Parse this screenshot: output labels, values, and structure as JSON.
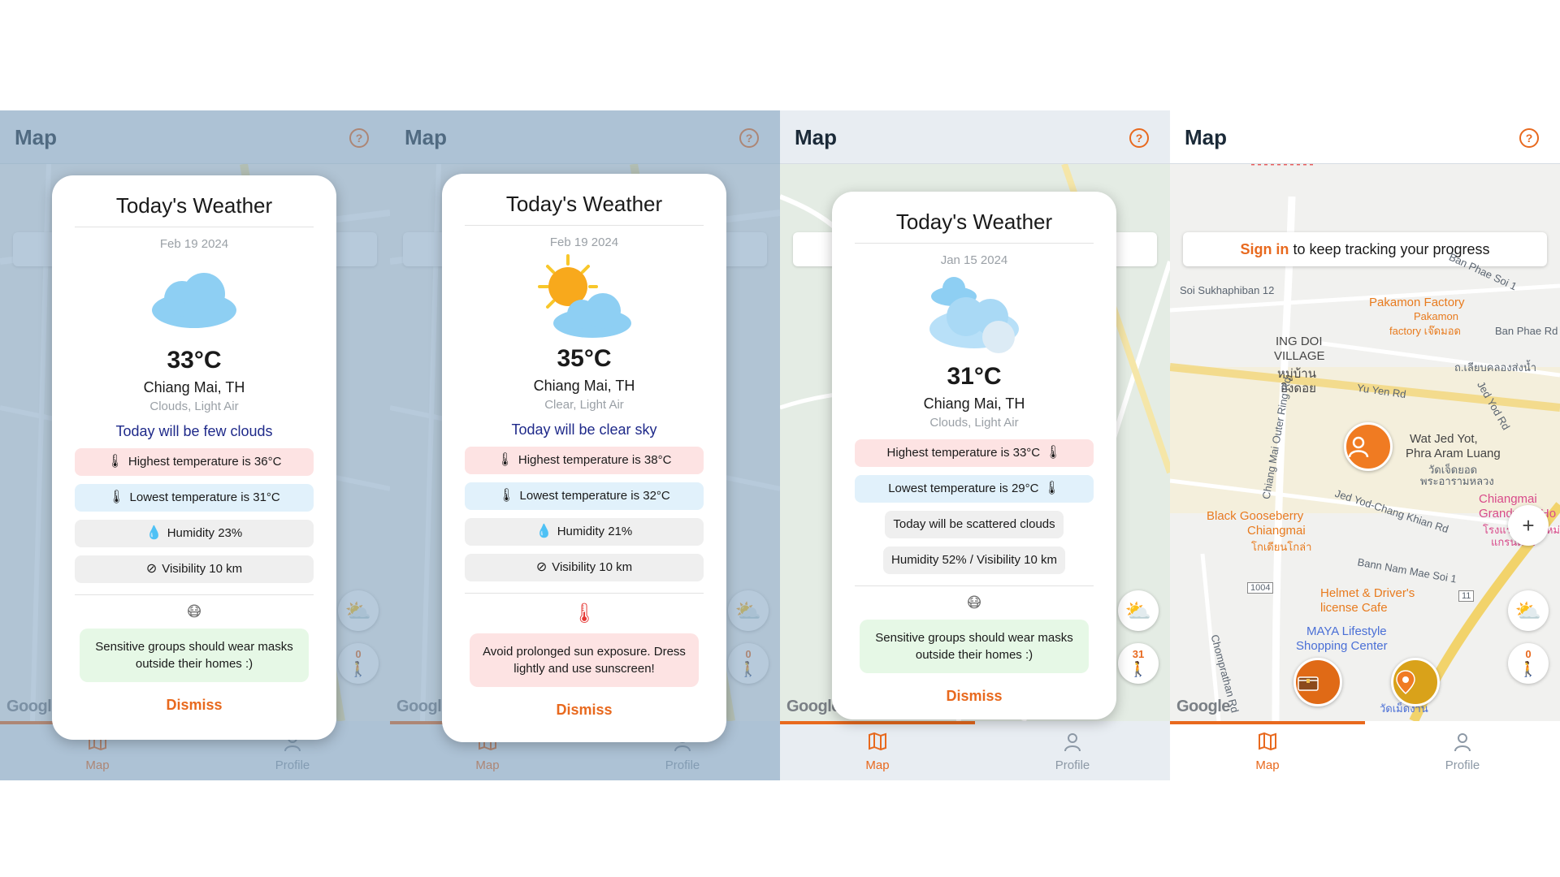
{
  "common": {
    "appbar_title": "Map",
    "help_glyph": "?",
    "google_logo": "Google",
    "nav_map": "Map",
    "nav_profile": "Profile",
    "plus_glyph": "+",
    "walk_glyph": "🚶",
    "steps_count": "0",
    "icons": [
      "question-circle-icon",
      "map-icon",
      "profile-icon",
      "thermometer-icon",
      "droplet-icon",
      "visibility-off-icon",
      "mask-icon",
      "plus-icon",
      "walk-icon"
    ]
  },
  "colors": {
    "accent": "#e8691e",
    "forecast_text": "#1f2a8a",
    "high_pill": "#fde3e3",
    "low_pill": "#e1f1fb",
    "advice_green": "#e6f8e6"
  },
  "panel1": {
    "title": "Today's Weather",
    "date": "Feb 19 2024",
    "temperature": "33°C",
    "city": "Chiang Mai, TH",
    "conditions": "Clouds, Light Air",
    "forecast": "Today will be few clouds",
    "high": "Highest temperature is 36°C",
    "low": "Lowest temperature is 31°C",
    "humidity": "Humidity 23%",
    "visibility": "Visibility 10 km",
    "advice": "Sensitive groups should wear masks outside their homes :)",
    "dismiss": "Dismiss"
  },
  "panel2": {
    "title": "Today's Weather",
    "date": "Feb 19 2024",
    "temperature": "35°C",
    "city": "Chiang Mai, TH",
    "conditions": "Clear, Light Air",
    "forecast": "Today will be clear sky",
    "high": "Highest temperature is 38°C",
    "low": "Lowest temperature is 32°C",
    "humidity": "Humidity 21%",
    "visibility": "Visibility 10 km",
    "advice": "Avoid prolonged sun exposure. Dress lightly and use sunscreen!",
    "dismiss": "Dismiss"
  },
  "panel3": {
    "title": "Today's Weather",
    "date": "Jan 15 2024",
    "temperature": "31°C",
    "city": "Chiang Mai, TH",
    "conditions": "Clouds, Light Air",
    "high": "Highest temperature is 33°C",
    "low": "Lowest temperature is 29°C",
    "forecast": "Today will be scattered clouds",
    "humidity_visibility": "Humidity 52% / Visibility 10 km",
    "advice": "Sensitive groups should wear masks outside their homes :)",
    "dismiss": "Dismiss",
    "steps_count": "31"
  },
  "panel4": {
    "signin_link": "Sign in",
    "signin_text": " to keep tracking your progress",
    "labels": {
      "soi_sukhaphiban": "Soi Sukhaphiban 12",
      "ban_phae_soi": "Ban Phae Soi 1",
      "pakamon_factory": "Pakamon Factory",
      "pakamon_th": "Pakamon",
      "pakamon_th2": "factory เจ๊ดมอด",
      "ban_phae_rd": "Ban Phae Rd",
      "ing_doi": "ING DOI",
      "village": "VILLAGE",
      "village_th1": "หมู่บ้าน",
      "village_th2": "อิงดอย",
      "th_road": "ถ.เลียบคลองส่งน้ำ",
      "yu_yen_rd": "Yu Yen Rd",
      "jed_yod_rd": "Jed Yod Rd",
      "outer_ring": "Chiang Mai Outer Ring Rd",
      "wat_jed_yot": "Wat Jed Yot,",
      "phra_aram": "Phra Aram Luang",
      "wat_th1": "วัดเจ็ดยอด",
      "wat_th2": "พระอารามหลวง",
      "jed_yod_chang": "Jed Yod-Chang Khian Rd",
      "chiangmai_grandview": "Chiangmai",
      "grandview": "Grandview Ho",
      "grandview_th1": "โรงแรมเชียงใหม่",
      "grandview_th2": "แกรนด์วิว",
      "black_gooseberry": "Black Gooseberry",
      "gooseberry_cm": "Chiangmai",
      "gooseberry_th": "โกเดียนโกล่า",
      "bann_nam_mae": "Bann Nam Mae Soi 1",
      "road_1004": "1004",
      "helmet": "Helmet & Driver's",
      "license_cafe": "license Cafe",
      "maya": "MAYA Lifestyle",
      "maya2": "Shopping Center",
      "chomprathan": "Chomprathan Rd",
      "wat_th_bottom": "วัดเม็ดงาน",
      "road_11": "11"
    }
  }
}
